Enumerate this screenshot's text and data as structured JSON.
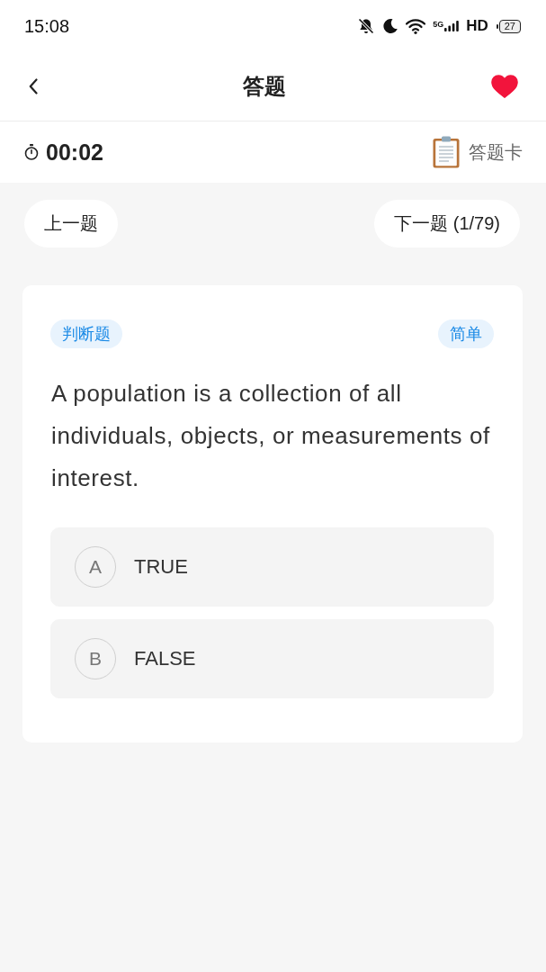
{
  "status_bar": {
    "time": "15:08",
    "network": "5G",
    "hd": "HD",
    "battery": "27"
  },
  "header": {
    "title": "答题",
    "favorited": true
  },
  "toolbar": {
    "timer": "00:02",
    "answer_card": "答题卡"
  },
  "nav": {
    "prev": "上一题",
    "next": "下一题 (1/79)"
  },
  "question": {
    "type_tag": "判断题",
    "difficulty_tag": "简单",
    "text": "A population is a collection of all individuals, objects, or measurements of interest.",
    "options": [
      {
        "letter": "A",
        "text": "TRUE",
        "selected": false
      },
      {
        "letter": "B",
        "text": "FALSE",
        "selected": false
      }
    ]
  }
}
